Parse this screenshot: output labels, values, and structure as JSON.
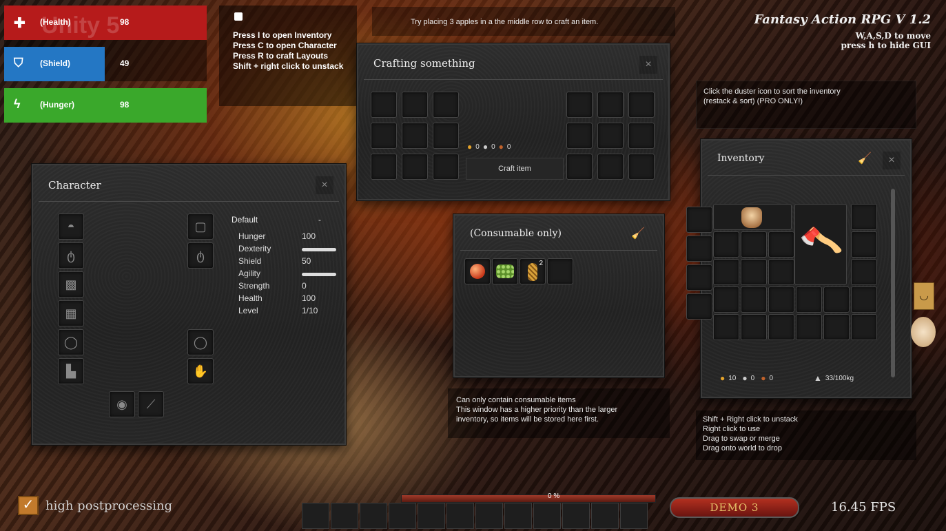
{
  "bars": [
    {
      "label": "(Health)",
      "value": "98",
      "color": "#b91c1c",
      "icon": "plus-icon"
    },
    {
      "label": "(Shield)",
      "value": "49",
      "color": "#2477c4",
      "icon": "shield-icon"
    },
    {
      "label": "(Hunger)",
      "value": "98",
      "color": "#3aa82b",
      "icon": "bolt-icon"
    }
  ],
  "help": {
    "lines": [
      "Press I to open Inventory",
      "Press C to open Character",
      "Press R to craft Layouts",
      "Shift + right click to unstack"
    ]
  },
  "top_hint": "Try placing 3 apples in a the middle row to craft an item.",
  "game_title": {
    "title": "Fantasy Action RPG V 1.2",
    "line1": "W,A,S,D to move",
    "line2": "press h to hide GUI"
  },
  "crafting": {
    "title": "Crafting something",
    "close": "×",
    "currency": [
      "0",
      "0",
      "0"
    ],
    "craft_button": "Craft item"
  },
  "sort_tip": "Click the duster icon to sort the inventory (restack & sort) (PRO ONLY!)",
  "character": {
    "title": "Character",
    "close": "×",
    "preset": "Default",
    "preset_action": "-",
    "stats": [
      {
        "name": "Hunger",
        "value": "100"
      },
      {
        "name": "Dexterity",
        "value": "",
        "bar": 1.0
      },
      {
        "name": "Shield",
        "value": "50"
      },
      {
        "name": "Agility",
        "value": "",
        "bar": 1.0
      },
      {
        "name": "Strength",
        "value": "0"
      },
      {
        "name": "Health",
        "value": "100"
      },
      {
        "name": "Level",
        "value": "1/10"
      }
    ]
  },
  "consumable": {
    "title": "(Consumable only)",
    "pineapple_count": "2",
    "info_lines": [
      "Can only contain consumable items",
      "This window has a higher priority than the larger",
      "inventory, so items will be stored here first."
    ]
  },
  "inventory": {
    "title": "Inventory",
    "close": "×",
    "currency": [
      "10",
      "0",
      "0"
    ],
    "weight": "33/100kg",
    "tips": [
      "Shift + Right click to unstack",
      "Right click to use",
      "Drag to swap or merge",
      "Drag onto world to drop"
    ]
  },
  "bottom": {
    "postprocessing": "high postprocessing",
    "xp": "0 %",
    "demo": "DEMO 3",
    "fps": "16.45 FPS"
  },
  "watermark": "Unity 5"
}
